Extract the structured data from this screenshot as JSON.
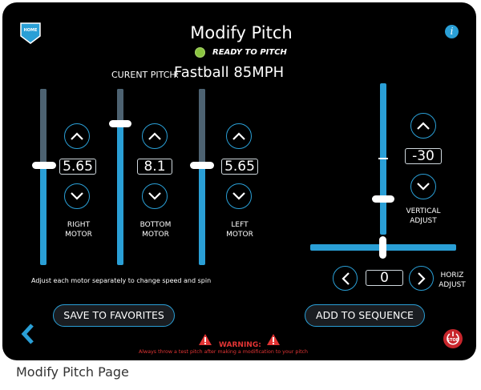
{
  "header": {
    "home_label": "HOME",
    "title": "Modify Pitch",
    "info_label": "i",
    "status": "READY TO PITCH"
  },
  "current_pitch": {
    "label": "CURENT PITCH:",
    "value": "Fastball 85MPH"
  },
  "motors": [
    {
      "label_line1": "RIGHT",
      "label_line2": "MOTOR",
      "value": "5.65",
      "level": 0.6
    },
    {
      "label_line1": "BOTTOM",
      "label_line2": "MOTOR",
      "value": "8.1",
      "level": 0.81
    },
    {
      "label_line1": "LEFT",
      "label_line2": "MOTOR",
      "value": "5.65",
      "level": 0.6
    }
  ],
  "hint": "Adjust each motor separately to change speed and spin",
  "vertical_adjust": {
    "label_line1": "VERTICAL",
    "label_line2": "ADJUST",
    "value": "-30",
    "level": 0.39
  },
  "horiz_adjust": {
    "label_line1": "HORIZ",
    "label_line2": "ADJUST",
    "value": "0",
    "level": 0.5
  },
  "buttons": {
    "save_favorites": "SAVE TO FAVORITES",
    "add_sequence": "ADD TO SEQUENCE",
    "stop": "STOP"
  },
  "warning": {
    "title": "WARNING:",
    "text": "Always throw a test pitch after making a modification to your pitch"
  },
  "caption": "Modify Pitch Page",
  "colors": {
    "accent": "#2a9fd6",
    "ready": "#8ac43f",
    "warning": "#e23434",
    "stop": "#c8262c"
  }
}
